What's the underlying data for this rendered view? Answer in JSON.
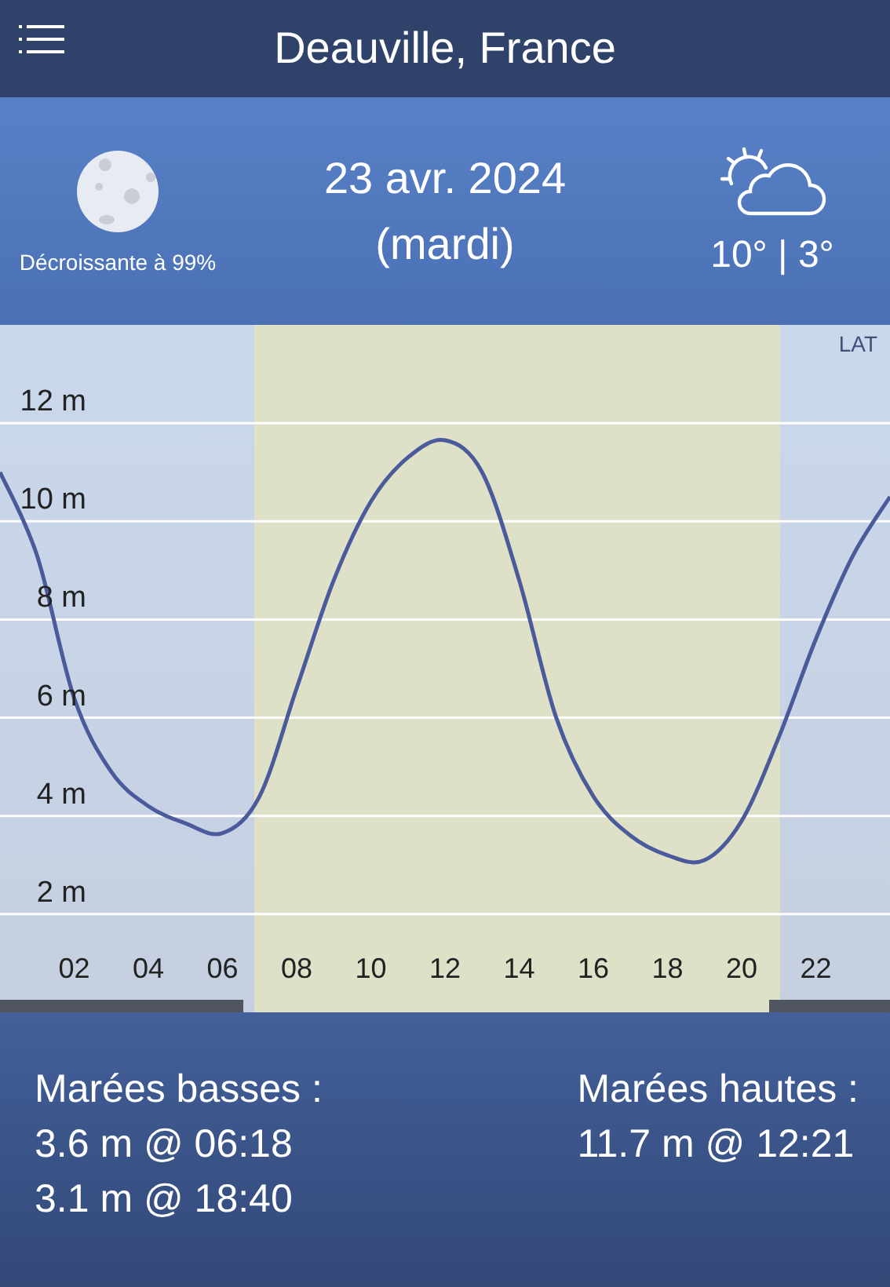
{
  "header": {
    "title": "Deauville, France"
  },
  "summary": {
    "moon_phase": "Décroissante à 99%",
    "date": "23 avr. 2024",
    "weekday": "(mardi)",
    "temperatures": "10° | 3°"
  },
  "tide_chart": {
    "datum": "LAT",
    "chart_data": {
      "type": "line",
      "x": [
        0,
        1,
        2,
        3,
        4,
        5,
        6,
        7,
        8,
        9,
        10,
        11,
        12,
        13,
        14,
        15,
        16,
        17,
        18,
        19,
        20,
        21,
        22,
        23,
        24
      ],
      "series": [
        {
          "color": "#4a5a9a",
          "values": [
            11.0,
            9.3,
            6.4,
            4.9,
            4.2,
            3.85,
            3.65,
            4.4,
            6.6,
            8.8,
            10.4,
            11.3,
            11.65,
            11.0,
            8.8,
            6.0,
            4.4,
            3.6,
            3.2,
            3.1,
            3.9,
            5.6,
            7.6,
            9.3,
            10.5
          ]
        }
      ],
      "xlim": [
        0,
        24
      ],
      "ylim": [
        0,
        14
      ],
      "xticks": [
        {
          "value": 2,
          "label": "02"
        },
        {
          "value": 4,
          "label": "04"
        },
        {
          "value": 6,
          "label": "06"
        },
        {
          "value": 8,
          "label": "08"
        },
        {
          "value": 10,
          "label": "10"
        },
        {
          "value": 12,
          "label": "12"
        },
        {
          "value": 14,
          "label": "14"
        },
        {
          "value": 16,
          "label": "16"
        },
        {
          "value": 18,
          "label": "18"
        },
        {
          "value": 20,
          "label": "20"
        },
        {
          "value": 22,
          "label": "22"
        }
      ],
      "yticks": [
        {
          "value": 2,
          "label": "2 m"
        },
        {
          "value": 4,
          "label": "4 m"
        },
        {
          "value": 6,
          "label": "6 m"
        },
        {
          "value": 8,
          "label": "8 m"
        },
        {
          "value": 10,
          "label": "10 m"
        },
        {
          "value": 12,
          "label": "12 m"
        }
      ],
      "grid": true
    }
  },
  "tides": {
    "low": {
      "title": "Marées basses :",
      "entries": [
        "3.6 m @ 06:18",
        "3.1 m @ 18:40"
      ]
    },
    "high": {
      "title": "Marées hautes :",
      "entries": [
        "11.7 m @ 12:21"
      ]
    }
  }
}
